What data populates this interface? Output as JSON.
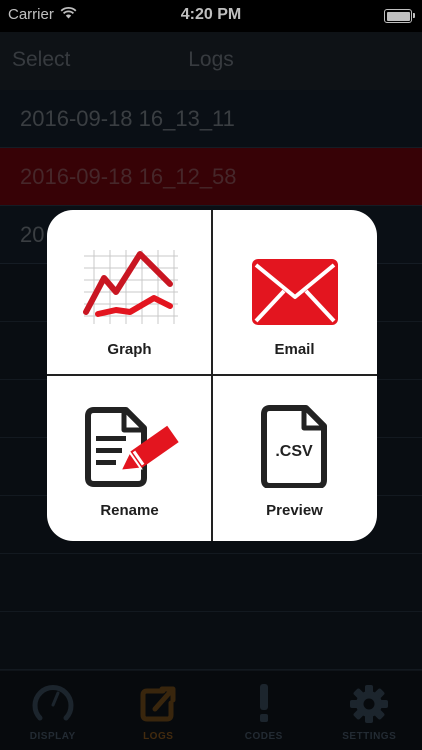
{
  "status_bar": {
    "carrier": "Carrier",
    "time": "4:20 PM"
  },
  "nav": {
    "left_button": "Select",
    "title": "Logs"
  },
  "logs": [
    {
      "label": "2016-09-18 16_13_11",
      "selected": false
    },
    {
      "label": "2016-09-18 16_12_58",
      "selected": true
    },
    {
      "label": "20",
      "selected": false
    }
  ],
  "popup": {
    "items": [
      {
        "label": "Graph",
        "icon": "graph-icon"
      },
      {
        "label": "Email",
        "icon": "envelope-icon"
      },
      {
        "label": "Rename",
        "icon": "rename-pencil-icon"
      },
      {
        "label": "Preview",
        "icon": "csv-file-icon",
        "icon_text": ".CSV"
      }
    ]
  },
  "tabs": [
    {
      "label": "DISPLAY",
      "icon": "gauge-icon",
      "active": false
    },
    {
      "label": "LOGS",
      "icon": "export-icon",
      "active": true
    },
    {
      "label": "CODES",
      "icon": "exclamation-icon",
      "active": false
    },
    {
      "label": "SETTINGS",
      "icon": "gear-icon",
      "active": false
    }
  ],
  "colors": {
    "accent_red": "#e3151f",
    "active_tab": "#5a3a14",
    "selected_row": "#4a0308"
  }
}
